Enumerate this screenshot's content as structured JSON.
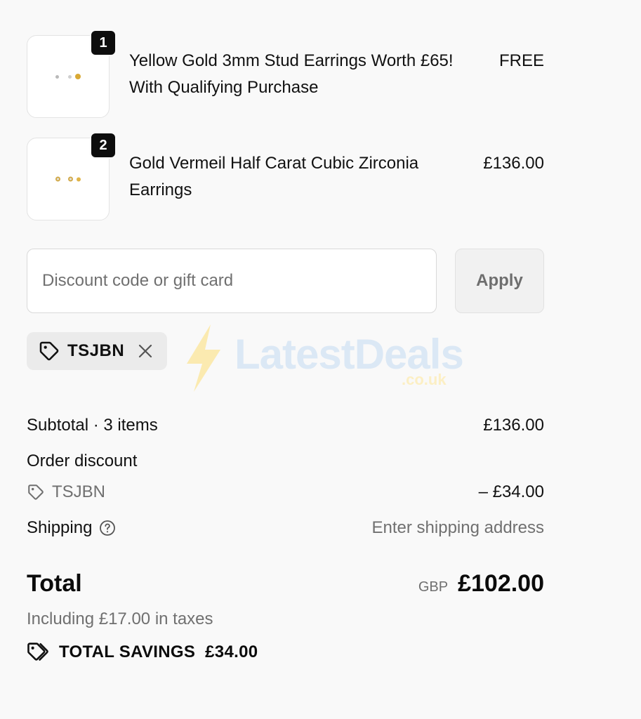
{
  "cart": {
    "items": [
      {
        "quantity": "1",
        "name": "Yellow Gold 3mm Stud Earrings Worth £65! With Qualifying Purchase",
        "price": "FREE"
      },
      {
        "quantity": "2",
        "name": "Gold Vermeil Half Carat Cubic Zirconia Earrings",
        "price": "£136.00"
      }
    ]
  },
  "discount": {
    "placeholder": "Discount code or gift card",
    "apply_label": "Apply",
    "applied_code": "TSJBN"
  },
  "watermark": {
    "brand": "LatestDeals",
    "suffix": ".co.uk"
  },
  "summary": {
    "subtotal_label": "Subtotal · 3 items",
    "subtotal_value": "£136.00",
    "order_discount_label": "Order discount",
    "discount_code": "TSJBN",
    "discount_value": "– £34.00",
    "shipping_label": "Shipping",
    "shipping_value": "Enter shipping address",
    "total_label": "Total",
    "currency": "GBP",
    "total_value": "£102.00",
    "tax_note": "Including £17.00 in taxes",
    "savings_label": "TOTAL SAVINGS",
    "savings_value": "£34.00"
  },
  "icons": {
    "tag": "tag-icon",
    "remove": "close-icon",
    "help": "question-circle-icon",
    "savings": "tags-icon"
  }
}
